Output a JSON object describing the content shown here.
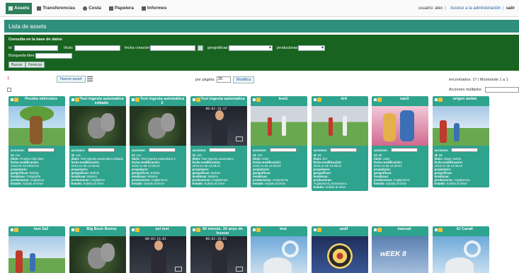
{
  "nav": {
    "items": [
      {
        "label": "Assets",
        "active": true,
        "icon": "film-icon"
      },
      {
        "label": "Transferencias",
        "active": false,
        "icon": "transfer-icon"
      },
      {
        "label": "Cesta",
        "active": false,
        "icon": "basket-icon"
      },
      {
        "label": "Papelera",
        "active": false,
        "icon": "trash-icon"
      },
      {
        "label": "Informes",
        "active": false,
        "icon": "report-icon"
      }
    ],
    "user_text": "usuario: alex",
    "admin_link": "Acceso a la administración",
    "logout": "salir"
  },
  "page_title": "Lista de assets",
  "search": {
    "header": "Consulta en la base de datos",
    "id_label": "id:",
    "titulo_label": "título:",
    "fecha_label": "fecha creación:",
    "geograficas_label": "geográficas:",
    "productoras_label": "productoras:",
    "busqueda_label": "Búsqueda libre:",
    "buscar_btn": "Buscar",
    "reiniciar_btn": "Reiniciar"
  },
  "toolbar": {
    "page_number": "1",
    "nuevo_asset": "Nuevo asset",
    "por_pagina_label": "por página:",
    "por_pagina_value": "25",
    "modifica_btn": "Modifica",
    "encontrados": "encontrados: 17 | Mostrando 1 a 1",
    "acciones_multiples": "Acciones múltiples:"
  },
  "field_labels": {
    "acciones": "acciones:",
    "id": "id:",
    "titulo": "título:",
    "fecha": "fecha modificación:",
    "propietario": "propietario:",
    "geograficas": "geográficas:",
    "tematicas": "temáticas:",
    "productoras": "productoras:",
    "estado": "Estado:"
  },
  "cards_row1": [
    {
      "title": "Prueba miércoles",
      "timecode": "",
      "id": "116",
      "titulo": "Prueba miércoles",
      "fecha": "2016-02-10 09:53:33",
      "geograficas": "Bolivia",
      "tematicas": "Fotografía",
      "productoras": "Anglaterra",
      "estado": "Subido al Drive",
      "thumb": "cartoon-tree"
    },
    {
      "title": "Test ingesta automatica editado",
      "timecode": "",
      "id": "115",
      "titulo": "Test ingesta automatica editado",
      "fecha": "2015-11-06 13:46:09",
      "geograficas": "Bolivia",
      "tematicas": "Música",
      "productoras": "Anglaterra",
      "estado": "Subido al Drive",
      "thumb": "cave"
    },
    {
      "title": "Test ingesta automática 2",
      "timecode": "",
      "id": "114",
      "titulo": "Test ingesta automática 2",
      "fecha": "2015-11-06 13:39:22",
      "geograficas": "Bolivia",
      "tematicas": "Música",
      "productoras": "Angilantonic",
      "estado": "Subido al Drive",
      "thumb": "cave"
    },
    {
      "title": "Test ingesta automatica",
      "timecode": "00:02:16:17",
      "id": "113",
      "titulo": "Test ingesta automatica",
      "fecha": "2015-11-06 13:39:22",
      "geograficas": "Bolivia",
      "tematicas": "Música",
      "productoras": "Angilantonic",
      "estado": "Subido al Drive",
      "thumb": "studio"
    },
    {
      "title": "test1",
      "timecode": "",
      "id": "101",
      "titulo": "test1",
      "fecha": "2015-11-06 13:39:22",
      "geograficas": "",
      "tematicas": "",
      "productoras": "Amiamerica",
      "estado": "Subido al Drive",
      "thumb": "field"
    },
    {
      "title": "dr4",
      "timecode": "",
      "id": "99",
      "titulo": "dr4",
      "fecha": "2015-11-06 13:39:22",
      "geograficas": "",
      "tematicas": "",
      "productoras": "Angilantonic,Amiamerica",
      "estado": "Subido al Drive",
      "thumb": "field"
    },
    {
      "title": "raw3",
      "timecode": "",
      "id": "98",
      "titulo": "raw3",
      "fecha": "2015-11-06 13:39:22",
      "geograficas": "",
      "tematicas": "",
      "productoras": "Angilantonic",
      "estado": "Subido al Drive",
      "thumb": "raw"
    },
    {
      "title": "origen webm",
      "timecode": "",
      "id": "96",
      "titulo": "origen webm",
      "fecha": "2015-11-06 13:39:22",
      "geograficas": "",
      "tematicas": "",
      "productoras": "Angilantonic",
      "estado": "Subido al Drive",
      "thumb": "kids"
    }
  ],
  "cards_row2": [
    {
      "title": "test 3a3",
      "timecode": "",
      "thumb": "kids"
    },
    {
      "title": "Big Buck Bunny",
      "timecode": "",
      "thumb": "cave"
    },
    {
      "title": "avi test",
      "timecode": "00:02:16:01",
      "thumb": "studio"
    },
    {
      "title": "60 minuts. 30 anys de buscar",
      "timecode": "00:02:16:01",
      "thumb": "studio"
    },
    {
      "title": "test",
      "timecode": "",
      "thumb": "ice"
    },
    {
      "title": "asdf",
      "timecode": "",
      "thumb": "dart"
    },
    {
      "title": "manual",
      "timecode": "",
      "thumb": "manual"
    },
    {
      "title": "El Cavall",
      "timecode": "",
      "thumb": "ice"
    }
  ],
  "colors": {
    "nav_active": "#2e7d5b",
    "title_bar": "#2f8f7b",
    "search_panel": "#18631f",
    "card": "#2ea38e"
  }
}
